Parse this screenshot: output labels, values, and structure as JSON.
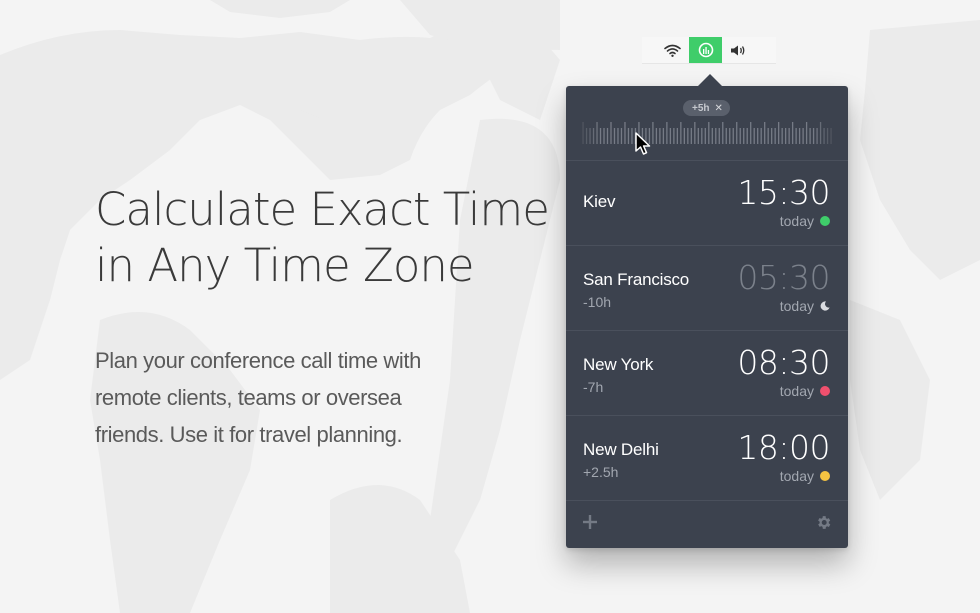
{
  "hero": {
    "title_lines": [
      "Calculate Exact Time",
      "in Any Time Zone"
    ],
    "body_lines": [
      "Plan your conference call time with",
      "remote clients, teams or oversea",
      "friends. Use it for travel planning."
    ]
  },
  "menubar": {
    "items": [
      {
        "icon": "wifi-icon",
        "active": false
      },
      {
        "icon": "timezone-app-icon",
        "active": true
      },
      {
        "icon": "volume-icon",
        "active": false
      }
    ]
  },
  "popover": {
    "offset_badge": "+5h",
    "offset_clear": "✕",
    "cities": [
      {
        "name": "Kiev",
        "offset": "",
        "time": "15:30",
        "day": "today",
        "indicator": "dot",
        "indicator_color": "#3fcd6a",
        "dim": false
      },
      {
        "name": "San Francisco",
        "offset": "-10h",
        "time": "05:30",
        "day": "today",
        "indicator": "moon",
        "indicator_color": "#d9dbe0",
        "dim": true
      },
      {
        "name": "New York",
        "offset": "-7h",
        "time": "08:30",
        "day": "today",
        "indicator": "dot",
        "indicator_color": "#f0506e",
        "dim": false
      },
      {
        "name": "New Delhi",
        "offset": "+2.5h",
        "time": "18:00",
        "day": "today",
        "indicator": "dot",
        "indicator_color": "#f5c342",
        "dim": false
      }
    ],
    "footer": {
      "add_icon": "plus-icon",
      "settings_icon": "gear-icon"
    }
  },
  "colors": {
    "accent": "#3fcd6a",
    "panel": "#3c424e",
    "background": "#f4f4f4"
  }
}
